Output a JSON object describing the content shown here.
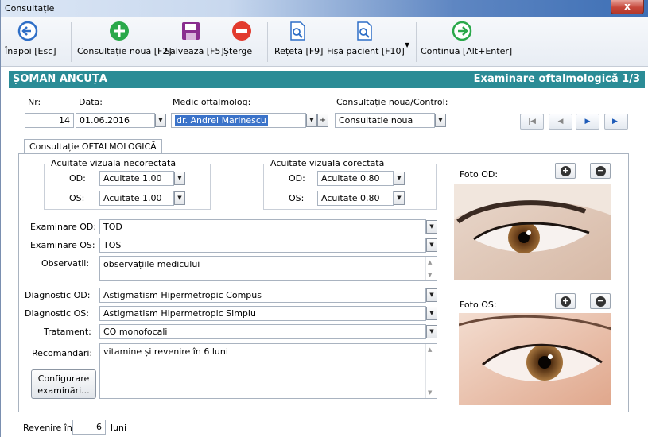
{
  "window": {
    "title": "Consultație",
    "close_label": "x"
  },
  "toolbar": {
    "back": "Înapoi [Esc]",
    "new_consult": "Consultație nouă [F2]",
    "save": "Salvează [F5]",
    "delete": "Șterge",
    "prescription": "Rețetă [F9]",
    "patient_file": "Fișă pacient [F10]",
    "continue": "Continuă [Alt+Enter]"
  },
  "header": {
    "patient_name": "ȘOMAN ANCUȚA",
    "exam_title": "Examinare oftalmologică 1/3"
  },
  "form": {
    "nr_label": "Nr:",
    "nr_value": "14",
    "date_label": "Data:",
    "date_value": "01.06.2016",
    "doctor_label": "Medic oftalmolog:",
    "doctor_value": "dr. Andrei Marinescu",
    "type_label": "Consultație nouă/Control:",
    "type_value": "Consultatie noua"
  },
  "tab": {
    "label": "Consultație OFTALMOLOGICĂ"
  },
  "acuity_uncorrected": {
    "title": "Acuitate vizuală necorectată",
    "od_label": "OD:",
    "od_value": "Acuitate 1.00",
    "os_label": "OS:",
    "os_value": "Acuitate 1.00"
  },
  "acuity_corrected": {
    "title": "Acuitate vizuală corectată",
    "od_label": "OD:",
    "od_value": "Acuitate 0.80",
    "os_label": "OS:",
    "os_value": "Acuitate 0.80"
  },
  "exam": {
    "od_label": "Examinare OD:",
    "od_value": "TOD",
    "os_label": "Examinare OS:",
    "os_value": "TOS",
    "notes_label": "Observații:",
    "notes_value": "observațiile medicului",
    "diag_od_label": "Diagnostic OD:",
    "diag_od_value": "Astigmatism Hipermetropic Compus",
    "diag_os_label": "Diagnostic OS:",
    "diag_os_value": "Astigmatism Hipermetropic Simplu",
    "treatment_label": "Tratament:",
    "treatment_value": "CO monofocali",
    "recommend_label": "Recomandări:",
    "recommend_value": "vitamine și revenire în 6 luni"
  },
  "photos": {
    "od_label": "Foto OD:",
    "os_label": "Foto OS:"
  },
  "config_button": {
    "line1": "Configurare",
    "line2": "examinări..."
  },
  "footer": {
    "return_label": "Revenire în",
    "return_value": "6",
    "return_unit": "luni"
  },
  "colors": {
    "header_bg": "#2b8c96",
    "selection": "#3b73c9",
    "icon_green": "#2aa84a",
    "icon_red": "#e23b2e",
    "icon_purple": "#8a2e8f",
    "icon_blue": "#2f6fc7"
  }
}
